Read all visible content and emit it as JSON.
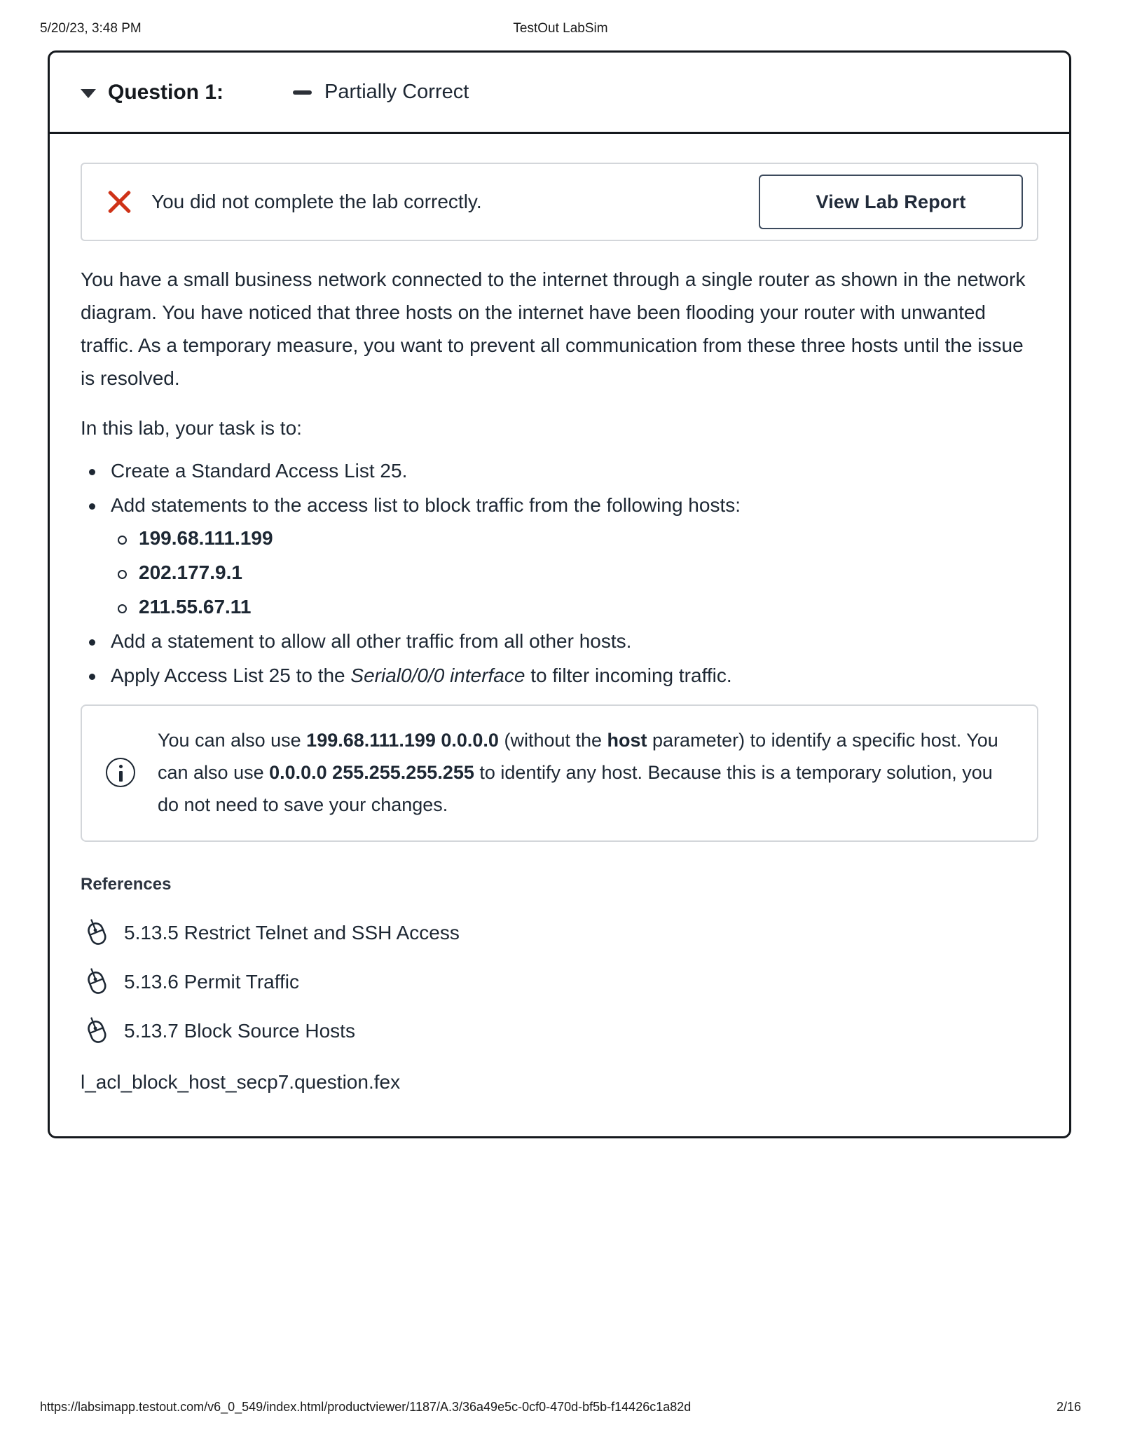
{
  "print_header": {
    "timestamp": "5/20/23, 3:48 PM",
    "title": "TestOut LabSim"
  },
  "question": {
    "label": "Question 1:",
    "status": "Partially Correct",
    "caret_icon": "chevron-down-icon",
    "status_icon": "minus-dash-icon"
  },
  "result_banner": {
    "icon": "red-x-icon",
    "message": "You did not complete the lab correctly.",
    "button_label": "View Lab Report",
    "icon_color": "#cf3217",
    "button_border_color": "#3c4a5d"
  },
  "scenario": {
    "paragraph": "You have a small business network connected to the internet through a single router as shown in the network diagram. You have noticed that three hosts on the internet have been flooding your router with unwanted traffic. As a temporary measure, you want to prevent all communication from these three hosts until the issue is resolved.",
    "task_intro": "In this lab, your task is to:"
  },
  "tasks": [
    {
      "text": "Create a Standard Access List 25."
    },
    {
      "text": "Add statements to the access list to block traffic from the following hosts:",
      "sub_items": [
        "199.68.111.199",
        "202.177.9.1",
        "211.55.67.11"
      ]
    },
    {
      "text": "Add a statement to allow all other traffic from all other hosts."
    },
    {
      "prefix": "Apply Access List 25 to the ",
      "emphasis": "Serial0/0/0 interface",
      "suffix": " to filter incoming traffic."
    }
  ],
  "info_box": {
    "icon": "info-circle-icon",
    "part1": "You can also use ",
    "bold1": "199.68.111.199 0.0.0.0",
    "part2": " (without the ",
    "bold2": "host",
    "part3": " parameter) to identify a specific host. You can also use ",
    "bold3": "0.0.0.0 255.255.255.255",
    "part4": " to identify any host. Because this is a temporary solution, you do not need to save your changes."
  },
  "references": {
    "heading": "References",
    "items": [
      {
        "icon": "mouse-icon",
        "label": "5.13.5 Restrict Telnet and SSH Access"
      },
      {
        "icon": "mouse-icon",
        "label": "5.13.6 Permit Traffic"
      },
      {
        "icon": "mouse-icon",
        "label": "5.13.7 Block Source Hosts"
      }
    ],
    "file_name": "l_acl_block_host_secp7.question.fex"
  },
  "print_footer": {
    "url": "https://labsimapp.testout.com/v6_0_549/index.html/productviewer/1187/A.3/36a49e5c-0cf0-470d-bf5b-f14426c1a82d",
    "page": "2/16"
  }
}
